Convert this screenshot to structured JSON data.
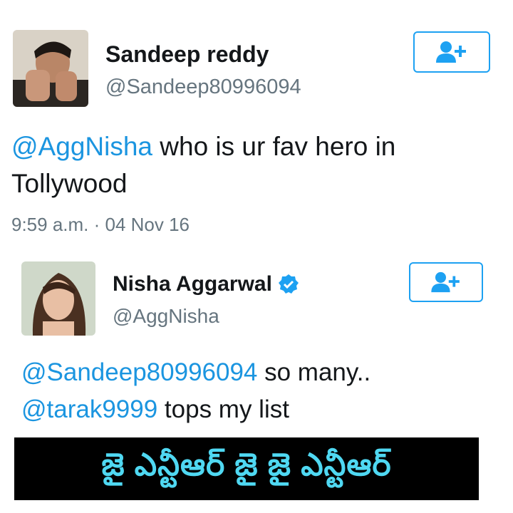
{
  "tweet": {
    "author_name": "Sandeep reddy",
    "author_handle": "@Sandeep80996094",
    "mention": "@AggNisha",
    "text_line1": " who is ur fav hero in",
    "text_line2": "Tollywood",
    "timestamp": "9:59 a.m. · 04 Nov 16"
  },
  "reply": {
    "author_name": "Nisha Aggarwal",
    "author_handle": "@AggNisha",
    "verified": true,
    "mention1": "@Sandeep80996094",
    "text1": " so many..",
    "mention2": "@tarak9999",
    "text2": " tops my list"
  },
  "banner": {
    "text": "జై ఎన్టీఆర్ జై జై ఎన్టీఆర్"
  },
  "colors": {
    "mention": "#1b95e0",
    "follow_border": "#1da1f2",
    "banner_text": "#4fd8f2",
    "banner_bg": "#000000"
  },
  "icons": {
    "follow": "add-user-icon",
    "verified": "verified-badge-icon"
  }
}
